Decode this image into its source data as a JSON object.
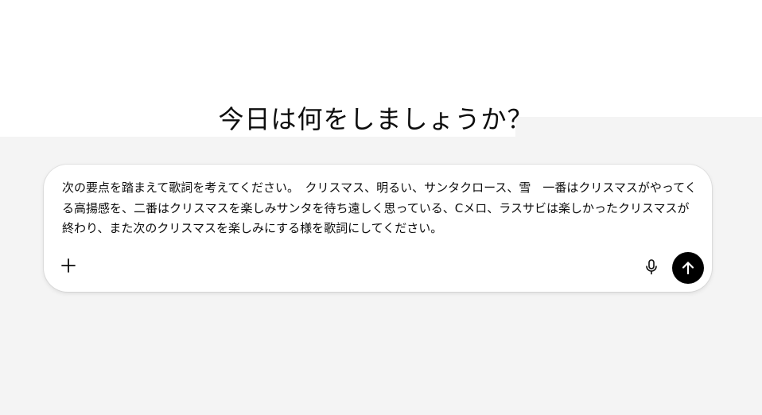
{
  "main": {
    "heading": "今日は何をしましょうか？"
  },
  "composer": {
    "input_value": "次の要点を踏まえて歌詞を考えてください。　クリスマス、明るい、サンタクロース、雪　一番はクリスマスがやってくる高揚感を、二番はクリスマスを楽しみサンタを待ち遠しく思っている、Cメロ、ラスサビは楽しかったクリスマスが終わり、また次のクリスマスを楽しみにする様を歌詞にしてください。",
    "icons": {
      "add": "plus-icon",
      "voice": "microphone-icon",
      "send": "arrow-up-icon"
    }
  },
  "colors": {
    "background_lower": "#f4f4f4",
    "composer_bg": "#ffffff",
    "send_button": "#000000",
    "text": "#0d0d0d"
  }
}
